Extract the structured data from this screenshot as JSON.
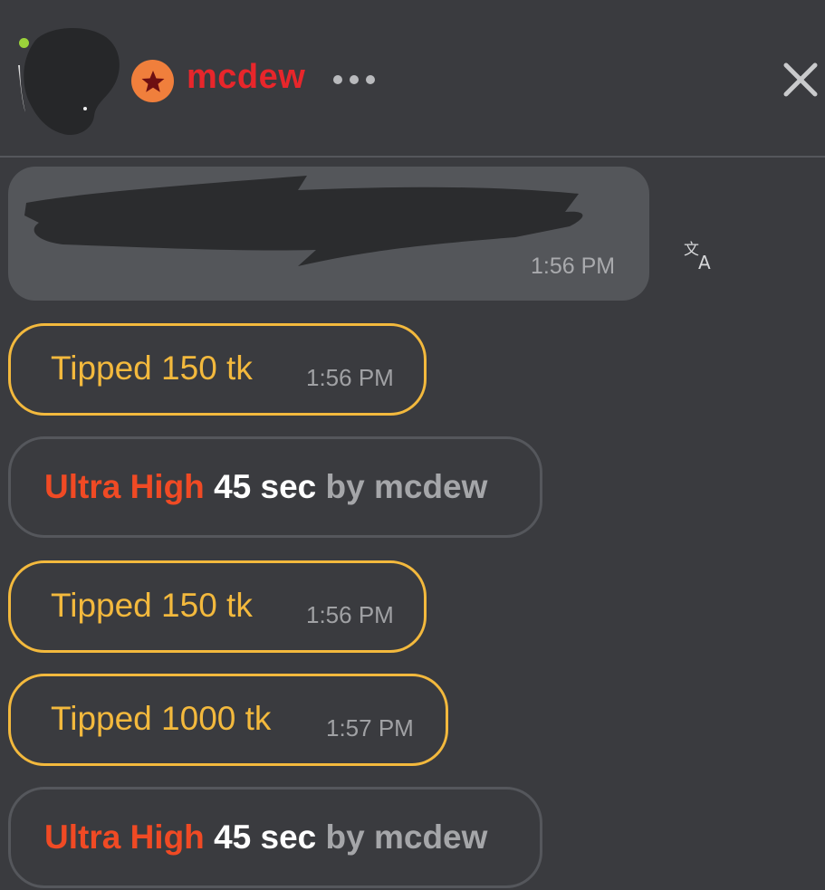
{
  "header": {
    "username": "mcdew",
    "icons": {
      "badge": "star-icon",
      "more": "more-options-icon",
      "close": "close-icon",
      "online": "online-status-dot"
    },
    "colors": {
      "username": "#e8262b",
      "badge": "#f07f3c",
      "online": "#9bd33a"
    }
  },
  "messages": [
    {
      "type": "text",
      "time": "1:56 PM",
      "translate_icon": "translate-icon"
    },
    {
      "type": "tip",
      "text": "Tipped 150 tk",
      "time": "1:56 PM"
    },
    {
      "type": "info",
      "level": "Ultra High",
      "duration": "45 sec",
      "by": "by mcdew"
    },
    {
      "type": "tip",
      "text": "Tipped 150 tk",
      "time": "1:56 PM"
    },
    {
      "type": "tip",
      "text": "Tipped 1000 tk",
      "time": "1:57 PM"
    },
    {
      "type": "info",
      "level": "Ultra High",
      "duration": "45 sec",
      "by": "by mcdew"
    }
  ],
  "colors": {
    "background": "#3a3b3f",
    "tip_accent": "#f3b93d",
    "level_accent": "#f04a24"
  }
}
